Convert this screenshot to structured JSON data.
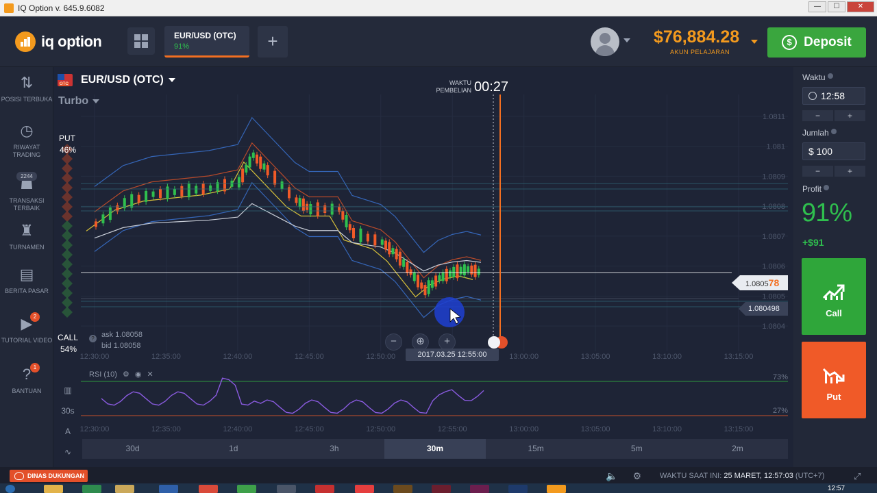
{
  "window": {
    "title": "IQ Option v. 645.9.6082"
  },
  "header": {
    "logo": "iq option",
    "asset_tab": {
      "name": "EUR/USD (OTC)",
      "percent": "91%"
    },
    "balance": "$76,884.28",
    "account_label": "AKUN PELAJARAN",
    "deposit_label": "Deposit"
  },
  "sidebar": {
    "items": [
      {
        "label": "POSISI TERBUKA",
        "icon": "arrows-updown-icon"
      },
      {
        "label": "RIWAYAT TRADING",
        "icon": "history-icon"
      },
      {
        "label": "TRANSAKSI TERBAIK",
        "icon": "people-icon",
        "count": "2244"
      },
      {
        "label": "TURNAMEN",
        "icon": "trophy-icon"
      },
      {
        "label": "BERITA PASAR",
        "icon": "news-icon"
      },
      {
        "label": "TUTORIAL VIDEO",
        "icon": "play-icon",
        "badge": "2"
      },
      {
        "label": "BANTUAN",
        "icon": "help-icon",
        "badge": "1"
      }
    ]
  },
  "chart": {
    "asset_title": "EUR/USD (OTC)",
    "mode": "Turbo",
    "put": {
      "label": "PUT",
      "percent": "46%"
    },
    "call": {
      "label": "CALL",
      "percent": "54%"
    },
    "buy_time_label_1": "WAKTU",
    "buy_time_label_2": "PEMBELIAN",
    "countdown": "00:27",
    "ask": "ask 1.08058",
    "bid": "bid 1.08058",
    "crosshair_time": "2017.03.25 12:55:00",
    "current_price_main": "1.0805",
    "current_price_tail": "78",
    "second_price": "1.080498",
    "rsi_label": "RSI (10)",
    "rsi_levels": [
      "73%",
      "27%"
    ],
    "tool_interval": "30s",
    "colors": {
      "up": "#2fbf4e",
      "down": "#f05a28",
      "accent": "#f36f21"
    }
  },
  "chart_data": {
    "type": "line",
    "title": "",
    "y_ticks": [
      "1.0811",
      "1.081",
      "1.0809",
      "1.0808",
      "1.0807",
      "1.0806",
      "1.0805",
      "1.0804"
    ],
    "x_ticks": [
      "12:30:00",
      "12:35:00",
      "12:40:00",
      "12:45:00",
      "12:50:00",
      "12:55:00",
      "13:00:00",
      "13:05:00",
      "13:10:00",
      "13:15:00"
    ],
    "ylim": [
      1.08035,
      1.08115
    ],
    "series": [
      {
        "x": [
          "12:30",
          "12:32",
          "12:34",
          "12:36",
          "12:38",
          "12:40",
          "12:41",
          "12:42",
          "12:44",
          "12:45",
          "12:47",
          "12:48",
          "12:50",
          "12:51",
          "12:52",
          "12:53",
          "12:54",
          "12:55",
          "12:56",
          "12:57"
        ],
        "values": [
          1.08074,
          1.08081,
          1.08084,
          1.08085,
          1.08086,
          1.08088,
          1.08097,
          1.08092,
          1.08082,
          1.08079,
          1.08079,
          1.08071,
          1.08068,
          1.08064,
          1.08058,
          1.08052,
          1.08056,
          1.08058,
          1.08059,
          1.080578
        ]
      }
    ],
    "timeframes": [
      "30d",
      "1d",
      "3h",
      "30m",
      "15m",
      "5m",
      "2m"
    ],
    "active_timeframe": "30m"
  },
  "right_panel": {
    "time_label": "Waktu",
    "time_value": "12:58",
    "amount_label": "Jumlah",
    "amount_value": "$  100",
    "minus": "−",
    "plus": "+",
    "profit_label": "Profit",
    "profit_pct": "91%",
    "profit_amt": "+$91",
    "call_label": "Call",
    "put_label": "Put"
  },
  "footer": {
    "support": "DINAS DUKUNGAN",
    "now_label": "WAKTU SAAT INI:",
    "now_value": "25 MARET, 12:57:03",
    "tz": "(UTC+7)"
  },
  "taskbar": {
    "clock": "12:57"
  }
}
